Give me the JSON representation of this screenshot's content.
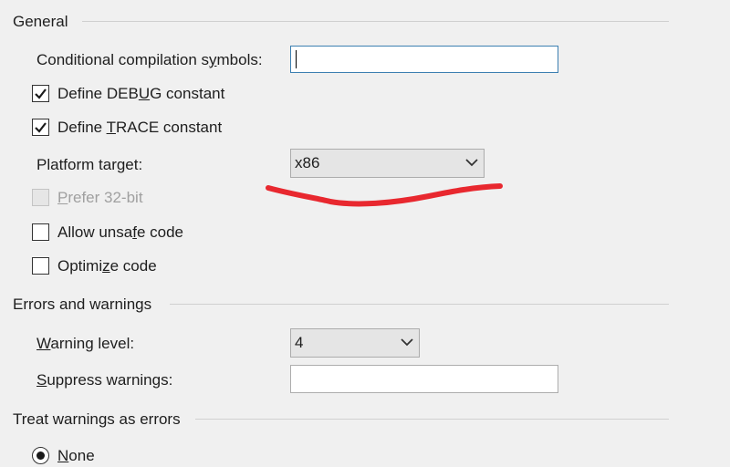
{
  "general": {
    "title": "General",
    "conditional_symbols": {
      "label_pre": "Conditional compilation s",
      "label_u": "y",
      "label_post": "mbols:",
      "value": ""
    },
    "define_debug": {
      "label_pre": "Define DEB",
      "label_u": "U",
      "label_post": "G constant",
      "checked": true
    },
    "define_trace": {
      "label_pre": "Define ",
      "label_u": "T",
      "label_post": "RACE constant",
      "checked": true
    },
    "platform_target": {
      "label": "Platform target:",
      "value": "x86"
    },
    "prefer_32bit": {
      "label_u": "P",
      "label_post": "refer 32-bit",
      "checked": false,
      "enabled": false
    },
    "allow_unsafe": {
      "label_pre": "Allow unsa",
      "label_u": "f",
      "label_post": "e code",
      "checked": false
    },
    "optimize": {
      "label_pre": "Optimi",
      "label_u": "z",
      "label_post": "e code",
      "checked": false
    }
  },
  "errors_warnings": {
    "title": "Errors and warnings",
    "warning_level": {
      "label_u": "W",
      "label_post": "arning level:",
      "value": "4"
    },
    "suppress_warnings": {
      "label_u": "S",
      "label_post": "uppress warnings:",
      "value": ""
    }
  },
  "treat_warnings": {
    "title": "Treat warnings as errors",
    "none_option": {
      "label_u": "N",
      "label_post": "one",
      "selected": true
    }
  },
  "annotation": {
    "color": "#e8282f"
  },
  "colors": {
    "background": "#f0f0f0",
    "focus_border": "#3c7fb1"
  }
}
